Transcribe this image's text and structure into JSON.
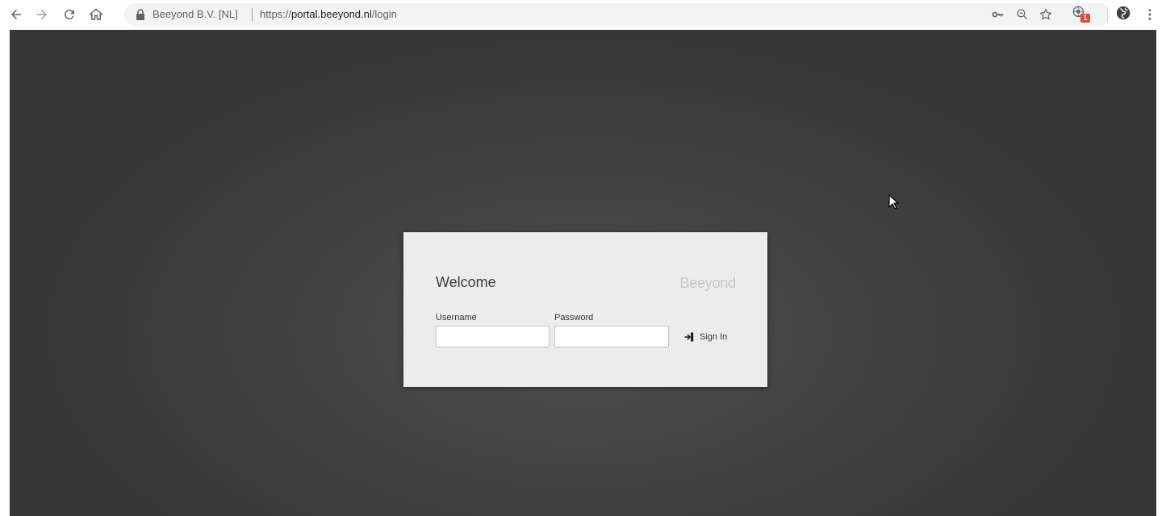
{
  "browser": {
    "site_identity": "Beeyond B.V. [NL]",
    "url_scheme": "https://",
    "url_host": "portal.beeyond.nl",
    "url_path": "/login",
    "extension_badge": "1",
    "icons": [
      "back-icon",
      "forward-icon",
      "reload-icon",
      "home-icon",
      "lock-icon",
      "key-icon",
      "zoom-icon",
      "star-icon",
      "extension-icon",
      "profile-icon",
      "menu-icon"
    ]
  },
  "login": {
    "welcome": "Welcome",
    "brand": "Beeyond",
    "username_label": "Username",
    "username_value": "",
    "password_label": "Password",
    "password_value": "",
    "signin_label": "Sign In"
  },
  "colors": {
    "page_bg": "#3d3d3d",
    "card_bg": "#ececec",
    "brand_text": "#c7c7c7",
    "badge": "#e8453c"
  }
}
